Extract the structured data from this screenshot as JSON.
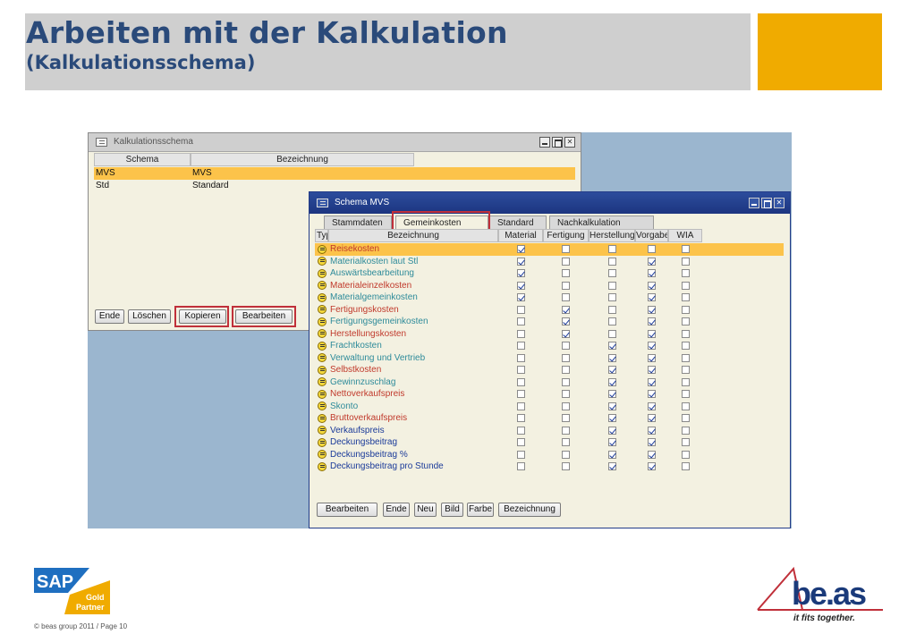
{
  "slide": {
    "title_line1": "Arbeiten mit der Kalkulation",
    "title_line2": "(Kalkulationsschema)",
    "accent_color": "#f0ab00",
    "title_color": "#2a4a7a",
    "footer": "© beas group 2011 / Page 10",
    "sap_logo": {
      "text": "SAP",
      "badge_line1": "Gold",
      "badge_line2": "Partner"
    },
    "beas_logo": {
      "text": "be.as",
      "tagline": "it fits together."
    }
  },
  "window_schema_list": {
    "title": "Kalkulationsschema",
    "columns": [
      "Schema",
      "Bezeichnung"
    ],
    "rows": [
      {
        "schema": "MVS",
        "bezeichnung": "MVS",
        "selected": true
      },
      {
        "schema": "Std",
        "bezeichnung": "Standard",
        "selected": false
      }
    ],
    "buttons": [
      "Ende",
      "Löschen",
      "Kopieren",
      "Bearbeiten"
    ]
  },
  "window_schema_detail": {
    "title": "Schema MVS",
    "tabs": [
      "Stammdaten",
      "Gemeinkosten",
      "Standard",
      "Nachkalkulation"
    ],
    "active_tab": "Gemeinkosten",
    "columns": [
      "Typ",
      "Bezeichnung",
      "Material",
      "Fertigung",
      "Herstellung",
      "Vorgabe",
      "WIA"
    ],
    "rows": [
      {
        "name": "Reisekosten",
        "color": "#c0392b",
        "checks": [
          true,
          false,
          false,
          false,
          false
        ],
        "selected": true
      },
      {
        "name": "Materialkosten laut Stl",
        "color": "#2e8b9a",
        "checks": [
          true,
          false,
          false,
          true,
          false
        ]
      },
      {
        "name": "Auswärtsbearbeitung",
        "color": "#2e8b9a",
        "checks": [
          true,
          false,
          false,
          true,
          false
        ]
      },
      {
        "name": "Materialeinzelkosten",
        "color": "#c0392b",
        "checks": [
          true,
          false,
          false,
          true,
          false
        ]
      },
      {
        "name": "Materialgemeinkosten",
        "color": "#2e8b9a",
        "checks": [
          true,
          false,
          false,
          true,
          false
        ]
      },
      {
        "name": "Fertigungskosten",
        "color": "#c0392b",
        "checks": [
          false,
          true,
          false,
          true,
          false
        ]
      },
      {
        "name": "Fertigungsgemeinkosten",
        "color": "#2e8b9a",
        "checks": [
          false,
          true,
          false,
          true,
          false
        ]
      },
      {
        "name": "Herstellungskosten",
        "color": "#c0392b",
        "checks": [
          false,
          true,
          false,
          true,
          false
        ]
      },
      {
        "name": "Frachtkosten",
        "color": "#2e8b9a",
        "checks": [
          false,
          false,
          true,
          true,
          false
        ]
      },
      {
        "name": "Verwaltung und Vertrieb",
        "color": "#2e8b9a",
        "checks": [
          false,
          false,
          true,
          true,
          false
        ]
      },
      {
        "name": "Selbstkosten",
        "color": "#c0392b",
        "checks": [
          false,
          false,
          true,
          true,
          false
        ]
      },
      {
        "name": "Gewinnzuschlag",
        "color": "#2e8b9a",
        "checks": [
          false,
          false,
          true,
          true,
          false
        ]
      },
      {
        "name": "Nettoverkaufspreis",
        "color": "#c0392b",
        "checks": [
          false,
          false,
          true,
          true,
          false
        ]
      },
      {
        "name": "Skonto",
        "color": "#2e8b9a",
        "checks": [
          false,
          false,
          true,
          true,
          false
        ]
      },
      {
        "name": "Bruttoverkaufspreis",
        "color": "#c0392b",
        "checks": [
          false,
          false,
          true,
          true,
          false
        ]
      },
      {
        "name": "Verkaufspreis",
        "color": "#1a3a99",
        "checks": [
          false,
          false,
          true,
          true,
          false
        ]
      },
      {
        "name": "Deckungsbeitrag",
        "color": "#1a3a99",
        "checks": [
          false,
          false,
          true,
          true,
          false
        ]
      },
      {
        "name": "Deckungsbeitrag %",
        "color": "#1a3a99",
        "checks": [
          false,
          false,
          true,
          true,
          false
        ]
      },
      {
        "name": "Deckungsbeitrag pro Stunde",
        "color": "#1a3a99",
        "checks": [
          false,
          false,
          true,
          true,
          false
        ]
      }
    ],
    "buttons": [
      "Bearbeiten",
      "Ende",
      "Neu",
      "Bild",
      "Farbe",
      "Bezeichnung"
    ]
  }
}
